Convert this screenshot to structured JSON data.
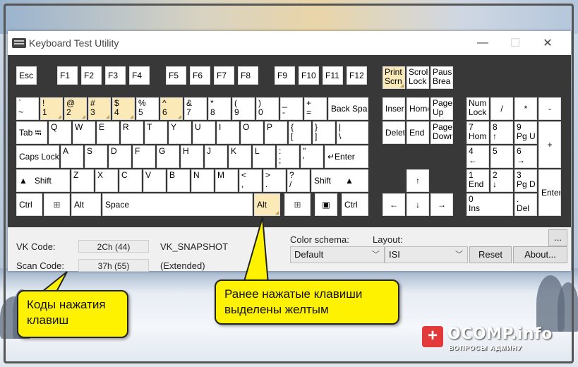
{
  "window": {
    "title": "Keyboard Test Utility",
    "controls": {
      "minimize": "—",
      "maximize": "☐",
      "close": "✕"
    }
  },
  "keyboard": {
    "highlight_color": "#fbe9b7",
    "keys": {
      "esc": "Esc",
      "f1": "F1",
      "f2": "F2",
      "f3": "F3",
      "f4": "F4",
      "f5": "F5",
      "f6": "F6",
      "f7": "F7",
      "f8": "F8",
      "f9": "F9",
      "f10": "F10",
      "f11": "F11",
      "f12": "F12",
      "print_screen": "Print\nScrn",
      "scroll_lock": "Scrol\nLock",
      "pause": "Paus\nBrea",
      "backquote": "`\n~",
      "d1": "!\n1",
      "d2": "@\n2",
      "d3": "#\n3",
      "d4": "$\n4",
      "d5": "%\n5",
      "d6": "^\n6",
      "d7": "&\n7",
      "d8": "*\n8",
      "d9": "(\n9",
      "d0": ")\n0",
      "minus": "_\n-",
      "equals": "+\n=",
      "backspace": "Back Spa",
      "tab": "Tab ⭾",
      "q": "Q",
      "w": "W",
      "e": "E",
      "r": "R",
      "t": "T",
      "y": "Y",
      "u": "U",
      "i": "I",
      "o": "O",
      "p": "P",
      "lbracket": "{\n[",
      "rbracket": "}\n]",
      "backslash": "|\n\\",
      "caps": "Caps Lock",
      "a": "A",
      "s": "S",
      "d": "D",
      "f": "F",
      "g": "G",
      "h": "H",
      "j": "J",
      "k": "K",
      "l": "L",
      "semicolon": ":\n;",
      "quote": "\"\n'",
      "enter": "↵Enter",
      "lshift": "▲   Shift",
      "z": "Z",
      "x": "X",
      "c": "C",
      "v": "V",
      "b": "B",
      "n": "N",
      "m": "M",
      "comma": "<\n,",
      "period": ">\n.",
      "slash": "?\n/",
      "rshift": "Shift      ▲",
      "lctrl": "Ctrl",
      "lwin": "⊞",
      "lalt": "Alt",
      "space": "Space",
      "ralt": "Alt",
      "rwin": "⊞",
      "menu": "▣",
      "rctrl": "Ctrl",
      "insert": "Inser",
      "home": "Home",
      "pgup": "Page\nUp",
      "delete": "Delet",
      "end": "End",
      "pgdn": "Page\nDown",
      "up": "↑",
      "left": "←",
      "down": "↓",
      "right": "→",
      "numlock": "Num\nLock",
      "np_div": "/",
      "np_mul": "*",
      "np_sub": "-",
      "np7": "7\nHom",
      "np8": "8\n↑",
      "np9": "9\nPg U",
      "np_add": "+",
      "np4": "4\n←",
      "np5": "5",
      "np6": "6\n→",
      "np1": "1\nEnd",
      "np2": "2\n↓",
      "np3": "3\nPg D",
      "np_enter": "Enter",
      "np0": "0\nIns",
      "np_dot": ".\nDel"
    }
  },
  "info": {
    "vk_label": "VK Code:",
    "vk_value": "2Ch (44)",
    "vk_name": "VK_SNAPSHOT",
    "scan_label": "Scan Code:",
    "scan_value": "37h (55)",
    "scan_ext": "(Extended)",
    "color_schema_label": "Color schema:",
    "color_schema_value": "Default",
    "layout_label": "Layout:",
    "layout_value": "ISI",
    "more_button": "...",
    "reset_button": "Reset",
    "about_button": "About..."
  },
  "callouts": {
    "left": "Коды нажатия\nклавиш",
    "right": "Ранее нажатые клавиши\nвыделены желтым",
    "color": "#fff200"
  },
  "watermark": {
    "name": "OCOMP.info",
    "sub": "ВОПРОСЫ АДМИНУ",
    "badge": "+"
  }
}
